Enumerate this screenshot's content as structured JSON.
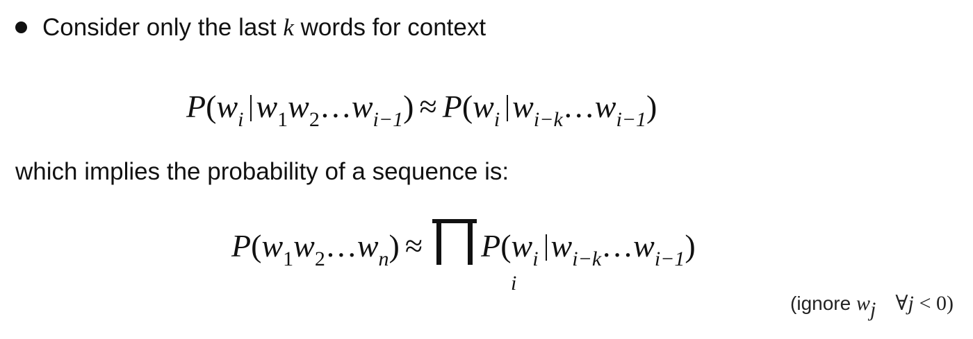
{
  "bullet": {
    "text_before": "Consider only the last",
    "var_k": "k",
    "text_after": "words for context"
  },
  "equation1": "P(w_i | w_1 w_2 … w_{i−1}) ≈ P(w_i | w_{i−k} … w_{i−1})",
  "line2": "which implies the probability of a sequence is:",
  "equation2": "P(w_1 w_2 … w_n) ≈ ∏_i P(w_i | w_{i−k} … w_{i−1})",
  "note": {
    "open": "(ignore",
    "var": "w",
    "sub": "j",
    "forall": "∀",
    "cond_var": "j",
    "cond": "< 0)"
  }
}
